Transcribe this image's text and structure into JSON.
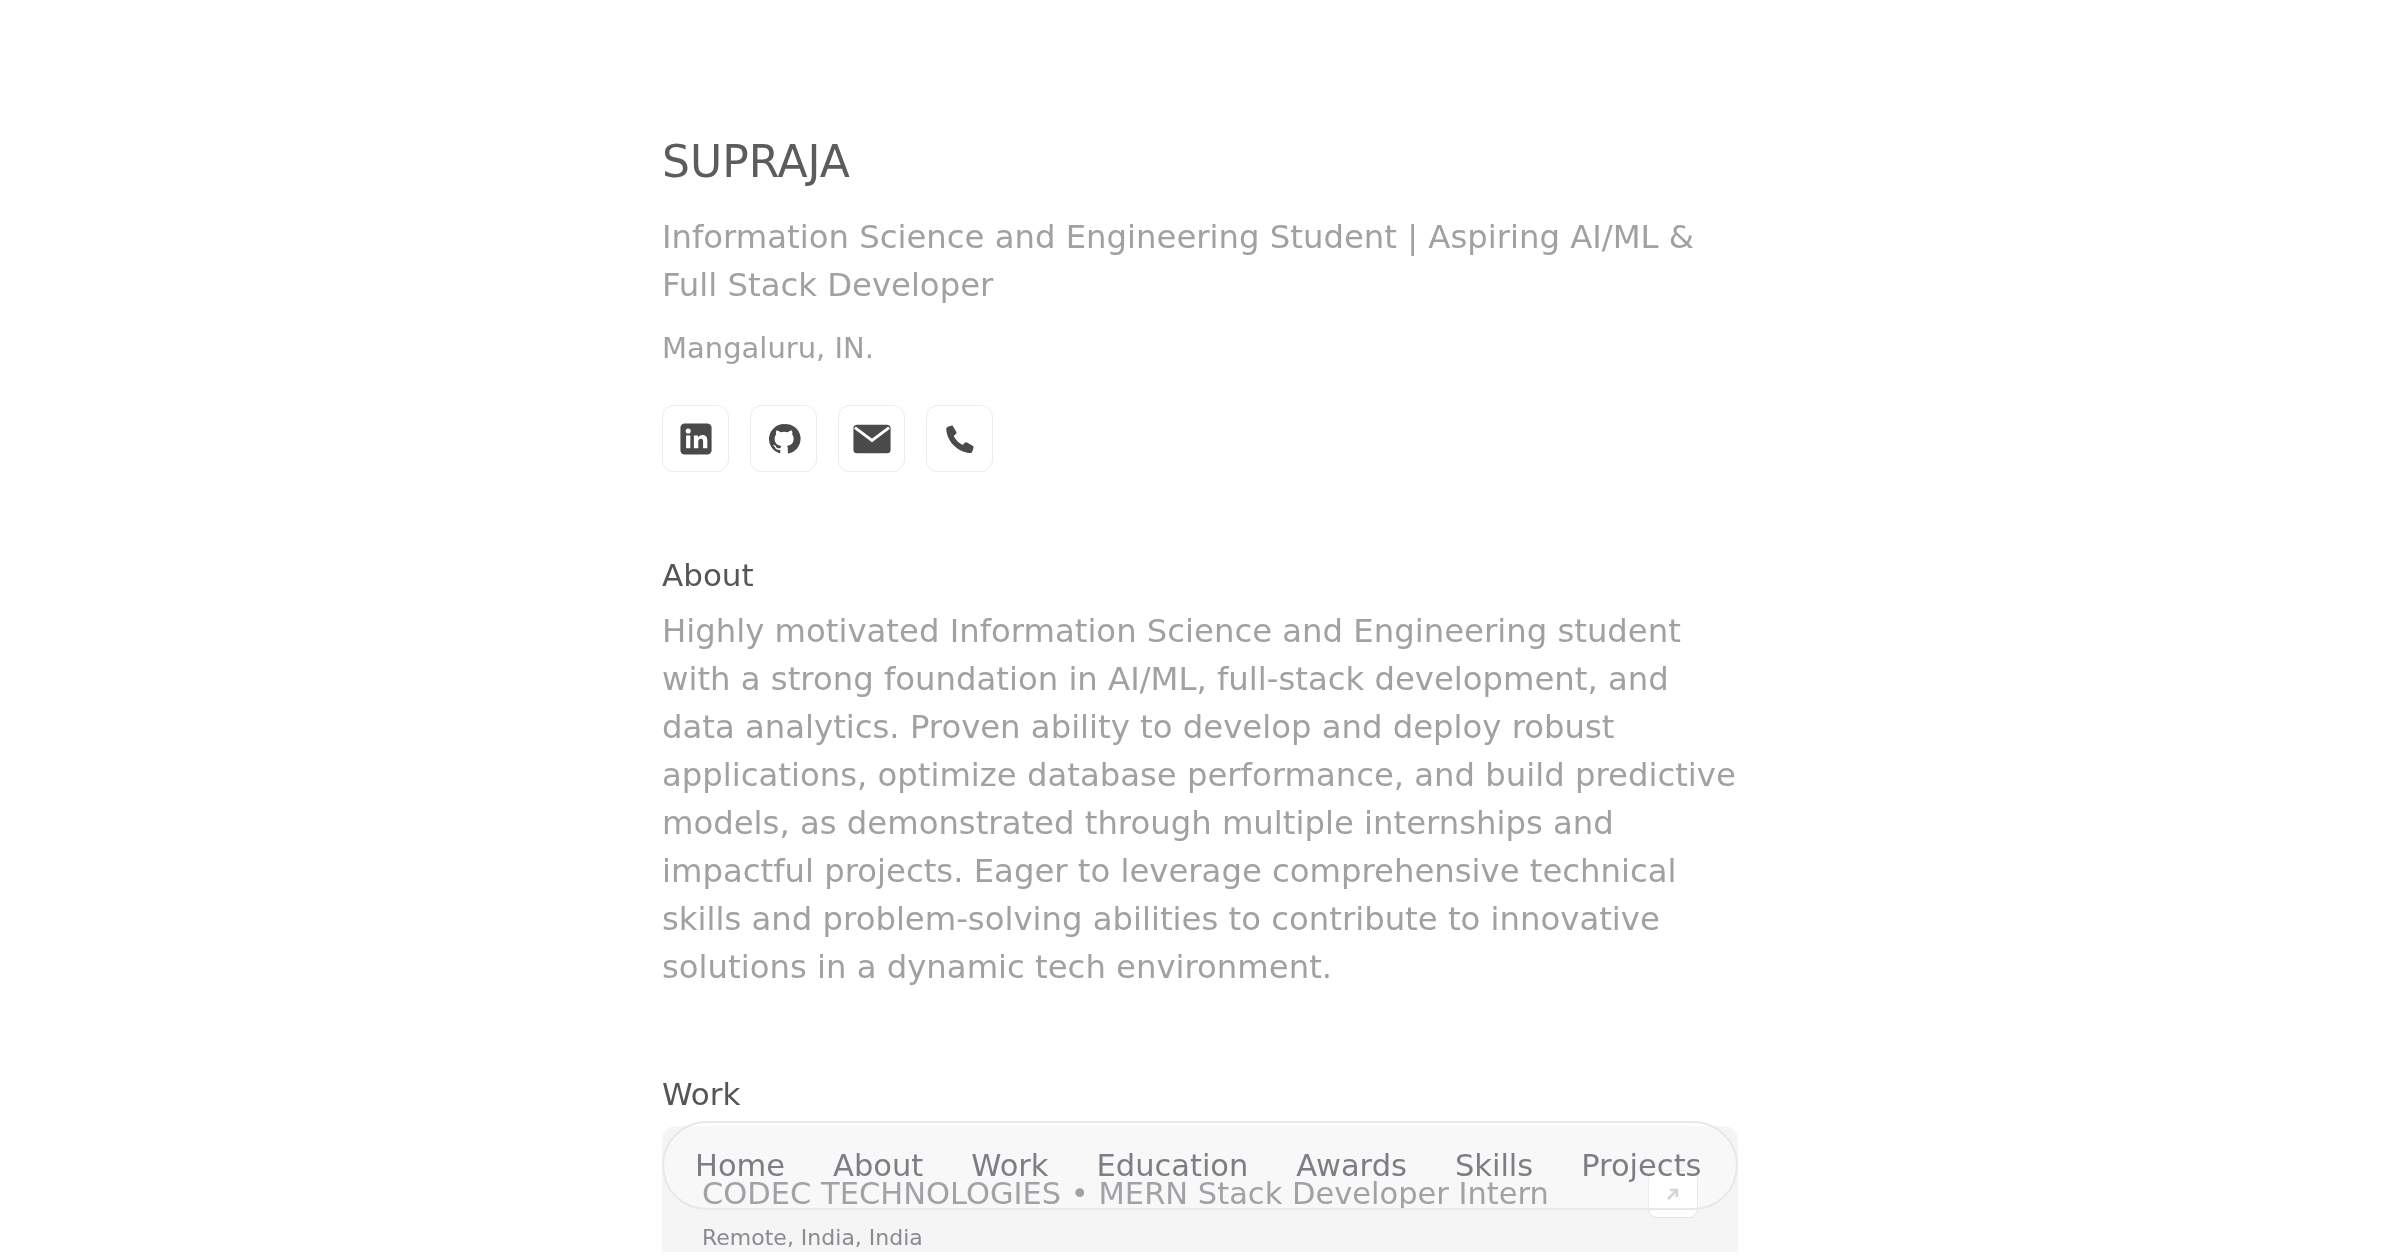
{
  "profile": {
    "name": "SUPRAJA",
    "headline": "Information Science and Engineering Student | Aspiring AI/ML & Full Stack Developer",
    "location": "Mangaluru, IN.",
    "links": [
      {
        "kind": "linkedin"
      },
      {
        "kind": "github"
      },
      {
        "kind": "email"
      },
      {
        "kind": "phone"
      }
    ]
  },
  "about": {
    "heading": "About",
    "text": "Highly motivated Information Science and Engineering student with a strong foundation in AI/ML, full-stack development, and data analytics. Proven ability to develop and deploy robust applications, optimize database performance, and build predictive models, as demonstrated through multiple internships and impactful projects. Eager to leverage comprehensive technical skills and problem-solving abilities to contribute to innovative solutions in a dynamic tech environment."
  },
  "work": {
    "heading": "Work",
    "entries": [
      {
        "title": "CODEC TECHNOLOGIES • MERN Stack Developer Intern",
        "location": "Remote, India, India"
      }
    ]
  },
  "nav": {
    "items": [
      {
        "label": "Home"
      },
      {
        "label": "About"
      },
      {
        "label": "Work"
      },
      {
        "label": "Education"
      },
      {
        "label": "Awards"
      },
      {
        "label": "Skills"
      },
      {
        "label": "Projects"
      }
    ]
  }
}
